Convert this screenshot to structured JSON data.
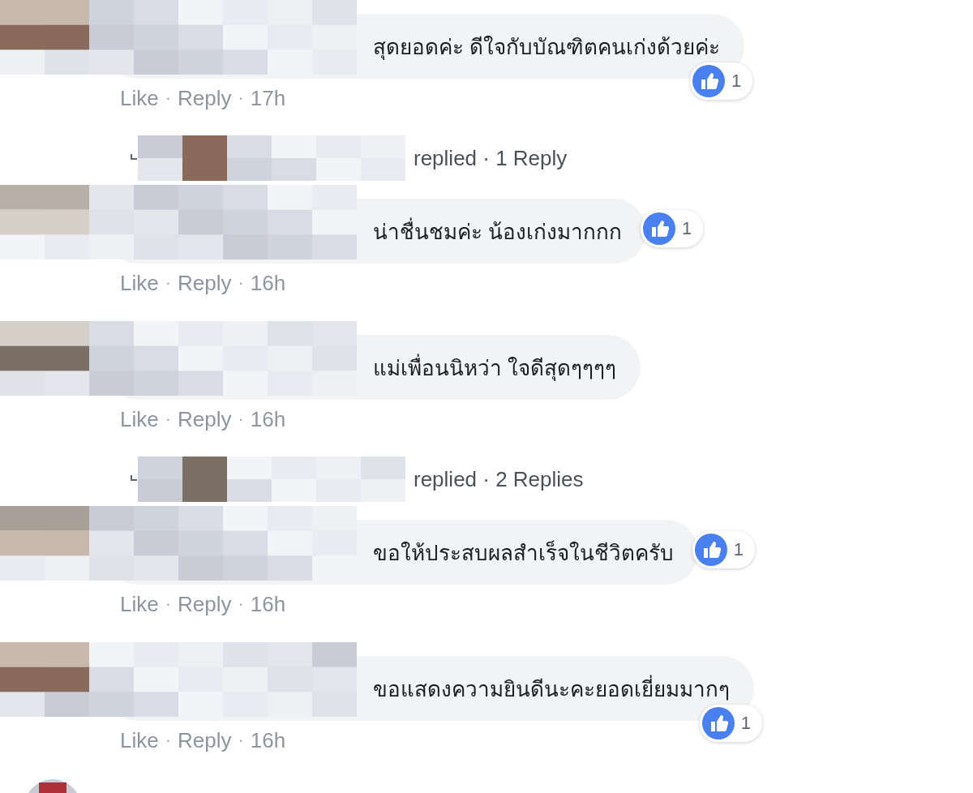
{
  "items": [
    {
      "kind": "comment",
      "text": "สุดยอดค่ะ ดีใจกับบัณฑิตคนเก่งด้วยค่ะ",
      "reactions": "1",
      "actions": [
        {
          "kind": "link",
          "text": "Like"
        },
        {
          "kind": "sep",
          "text": "·"
        },
        {
          "kind": "link",
          "text": "Reply"
        },
        {
          "kind": "sep",
          "text": "·"
        },
        {
          "kind": "time",
          "text": "17h"
        }
      ]
    },
    {
      "kind": "replies",
      "text": "replied · 1 Reply"
    },
    {
      "kind": "comment",
      "text": "น่าชื่นชมค่ะ น้องเก่งมากกก",
      "reactions": "1",
      "actions": [
        {
          "kind": "link",
          "text": "Like"
        },
        {
          "kind": "sep",
          "text": "·"
        },
        {
          "kind": "link",
          "text": "Reply"
        },
        {
          "kind": "sep",
          "text": "·"
        },
        {
          "kind": "time",
          "text": "16h"
        }
      ]
    },
    {
      "kind": "comment",
      "text": "แม่เพื่อนนิหว่า ใจดีสุดๆๆๆๆ",
      "actions": [
        {
          "kind": "link",
          "text": "Like"
        },
        {
          "kind": "sep",
          "text": "·"
        },
        {
          "kind": "link",
          "text": "Reply"
        },
        {
          "kind": "sep",
          "text": "·"
        },
        {
          "kind": "time",
          "text": "16h"
        }
      ]
    },
    {
      "kind": "replies",
      "text": "replied · 2 Replies"
    },
    {
      "kind": "comment",
      "text": "ขอให้ประสบผลสำเร็จในชีวิตครับ",
      "reactions": "1",
      "actions": [
        {
          "kind": "link",
          "text": "Like"
        },
        {
          "kind": "sep",
          "text": "·"
        },
        {
          "kind": "link",
          "text": "Reply"
        },
        {
          "kind": "sep",
          "text": "·"
        },
        {
          "kind": "time",
          "text": "16h"
        }
      ]
    },
    {
      "kind": "comment",
      "text": "ขอแสดงความยินดีนะคะยอดเยี่ยมมากๆ",
      "reactions": "1",
      "actions": [
        {
          "kind": "link",
          "text": "Like"
        },
        {
          "kind": "sep",
          "text": "·"
        },
        {
          "kind": "link",
          "text": "Reply"
        },
        {
          "kind": "sep",
          "text": "·"
        },
        {
          "kind": "time",
          "text": "16h"
        }
      ]
    },
    {
      "kind": "avatar_only"
    }
  ]
}
